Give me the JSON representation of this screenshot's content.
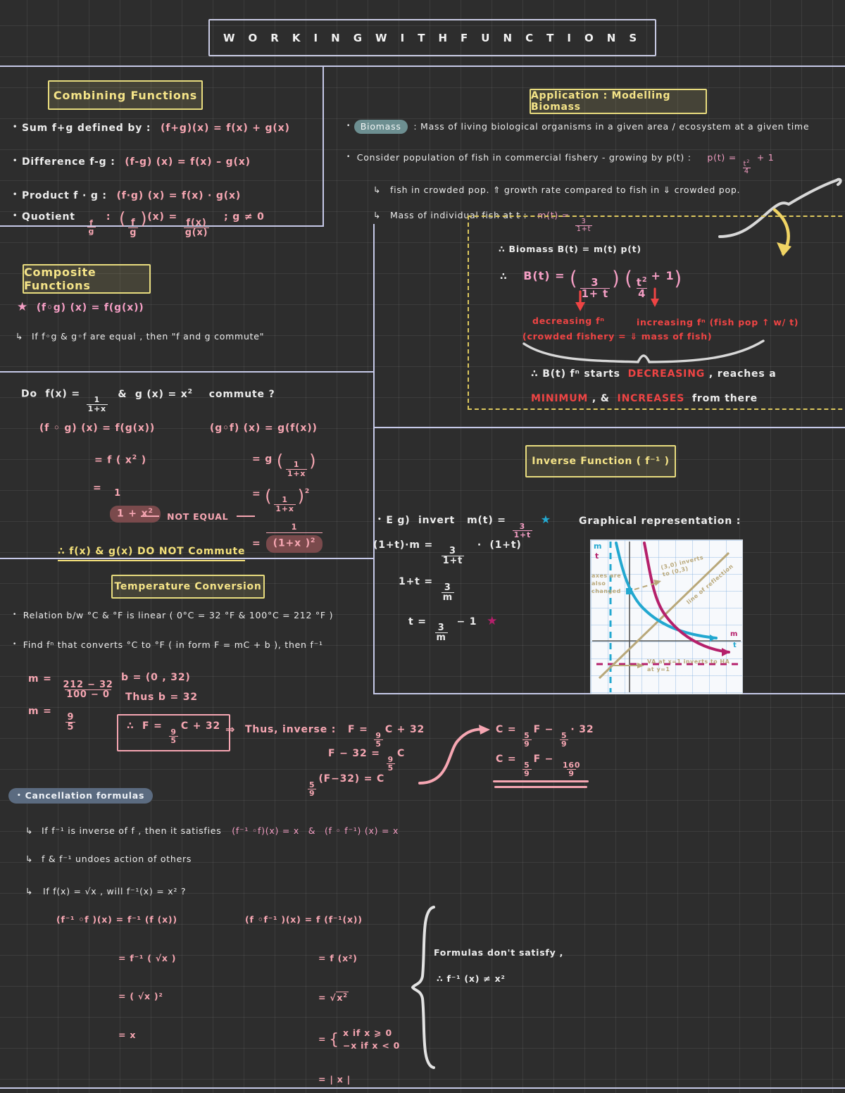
{
  "page": {
    "title": "W O R K I N G     W I T H     F U N C T I O N S",
    "bg_color": "#2d2d2d",
    "grid_color": "#474747",
    "rule_color": "#c6c9e8"
  },
  "combining": {
    "heading": "Combining   Functions",
    "items": [
      {
        "label": "Sum  f+g  defined  by :",
        "formula": "(f+g)(x) = f(x) + g(x)"
      },
      {
        "label": "Difference  f-g :",
        "formula": "(f-g) (x) =  f(x) - g(x)"
      },
      {
        "label": "Product  f · g :",
        "formula": "(f·g) (x) = f(x) · g(x)"
      },
      {
        "label": "Quotient",
        "formula": "( f/g )(x) = f(x)/g(x)  ;  g ≠ 0"
      }
    ],
    "quotient_sym": "f/g",
    "quotient_cond": "; g ≠ 0"
  },
  "composite": {
    "heading": "Composite  Functions",
    "star_rule": "(f◦g) (x) = f(g(x))",
    "note": "If f◦g & g◦f  are  equal , then \"f and g  commute\"",
    "question": "Do  f(x) = 1/(1+x)  &  g(x) = x²   commute ?",
    "left_col": [
      "(f ◦ g) (x) =  f(g(x))",
      "= f ( x² )",
      "= 1 / (1 + x²)"
    ],
    "right_col": [
      "(g◦f) (x) = g(f(x))",
      "= g ( 1/(1+x) )",
      "= ( 1/(1+x) )²",
      "= 1 / (1+x)²"
    ],
    "not_equal": "NOT  EQUAL",
    "conclusion": "∴ f(x) & g(x) DO NOT Commute"
  },
  "biomass": {
    "heading": "Application :  Modelling  Biomass",
    "term": "Biomass",
    "definition": ": Mass of living biological organisms in a given area / ecosystem at a given time",
    "consider": "Consider  population of fish  in  commercial  fishery -  growing  by  p(t) :",
    "p_formula": "p(t) = t²/4 + 1",
    "sub1": "fish in crowded pop. ⇑ growth rate compared to fish in ⇓ crowded pop.",
    "sub2": "Mass of individual fish at t :",
    "m_formula": "m(t) = 3/(1+t)",
    "line1": "∴  Biomass  B(t) =  m(t) p(t)",
    "line2": "∴   B(t) = ( 3/(1+t) ) ( t²/4 + 1 )",
    "annot_left": "decreasing fⁿ",
    "annot_left2": "(crowded fishery = ⇓ mass of fish)",
    "annot_right": "increasing fⁿ  (fish pop ↑ w/ t)",
    "result_pre": "∴ B(t) fⁿ starts",
    "result_kw1": "DECREASING",
    "result_mid": ", reaches a",
    "result_kw2": "MINIMUM",
    "result_amp": ", &",
    "result_kw3": "INCREASES",
    "result_end": "from there"
  },
  "inverse": {
    "heading": "Inverse  Function  ( f⁻¹ )",
    "eg": "E g)  invert   m(t) = 3/(1+t)",
    "steps": [
      "(1+t)·m =  3/(1+t)  ·  (1+t)",
      "1+t =  3/m",
      "t =  3/m  − 1"
    ],
    "graph_caption": "Graphical  representation :",
    "graph": {
      "axis_m": "m",
      "axis_t": "t",
      "axis_note": "axes are also changed",
      "label_point": "(3,0) inverts to (0,3)",
      "label_line": "line of reflection",
      "label_asym": "VA at x=1 inverts to HA at y=1",
      "x_axis_m": "m",
      "x_axis_t": "t"
    }
  },
  "temperature": {
    "heading": "Temperature   Conversion",
    "bullet1": "Relation b/w  °C &  °F  is  linear  ( 0°C = 32 °F & 100°C = 212 °F )",
    "bullet2": "Find fⁿ that converts °C to °F  ( in form  F = mC + b ), then f⁻¹",
    "m_calc1": "m =  (212 − 32) / (100 − 0)",
    "m_calc2": "m =  9/5",
    "b_calc1": "b = (0 , 32)",
    "b_calc2": "Thus  b = 32",
    "boxed": "∴  F = 9/5 C + 32",
    "arrow": "⇒",
    "thus": "Thus,  inverse :",
    "inv_steps": [
      "F = 9/5 C + 32",
      "F − 32 = 9/5 C",
      "5/9 (F−32) = C"
    ],
    "result1": "C = 5/9 F − 5/9 · 32",
    "result2": "C = 5/9 F − 160/9"
  },
  "cancellation": {
    "heading": "Cancellation  formulas",
    "b1_pre": "If f⁻¹ is inverse of f , then it satisfies",
    "b1_f1": "(f⁻¹ ◦f)(x) = x",
    "b1_amp": "&",
    "b1_f2": "(f ◦ f⁻¹) (x) = x",
    "b2": "f & f⁻¹  undoes  action of others",
    "b3": "If f(x) = √x ,  will  f⁻¹(x) = x² ?",
    "left_col": [
      "(f⁻¹ ◦f )(x) = f⁻¹ (f (x))",
      "= f⁻¹ ( √x )",
      "= ( √x )²",
      "= x"
    ],
    "right_col": [
      "(f ◦f⁻¹ )(x) = f (f⁻¹(x))",
      "= f (x²)",
      "= √(x²)",
      "= { x if x ⩾ 0 ,  −x if x < 0",
      "= | x |"
    ],
    "note1": "Formulas  don't  satisfy ,",
    "note2": "∴  f⁻¹ (x) ≠ x²"
  }
}
